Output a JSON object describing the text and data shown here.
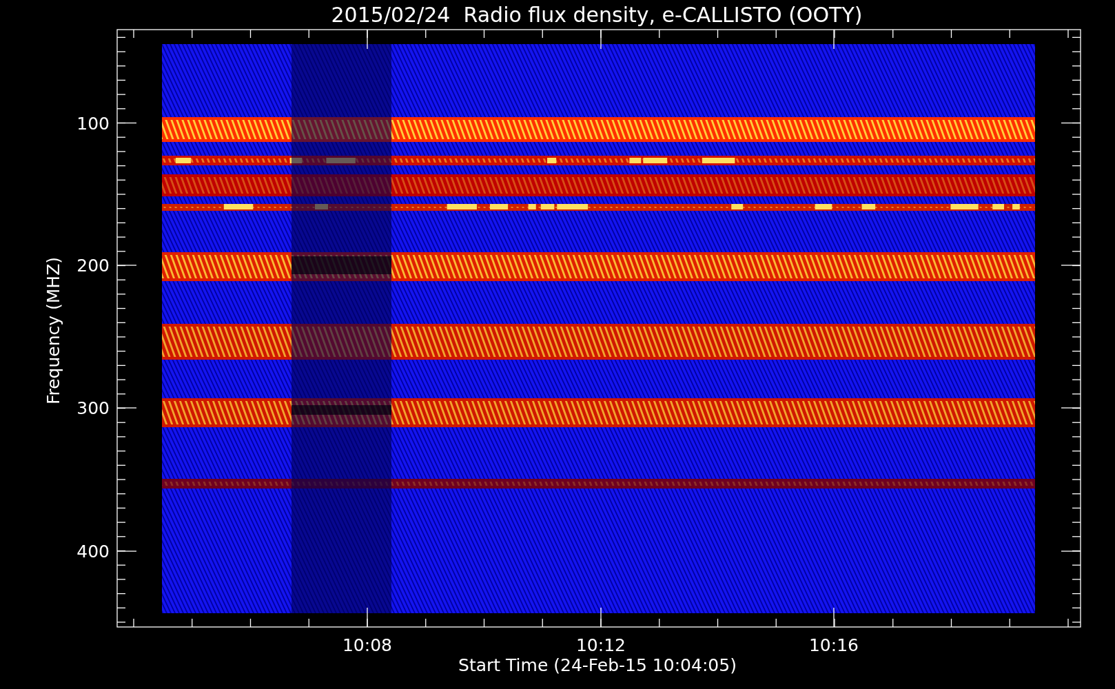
{
  "title": "2015/02/24  Radio flux density, e-CALLISTO (OOTY)",
  "y_axis": {
    "label": "Frequency (MHZ)",
    "ticks": [
      "100",
      "200",
      "300",
      "400"
    ]
  },
  "x_axis": {
    "label": "Start Time (24-Feb-15 10:04:05)",
    "ticks": [
      "10:08",
      "10:12",
      "10:16"
    ]
  }
}
